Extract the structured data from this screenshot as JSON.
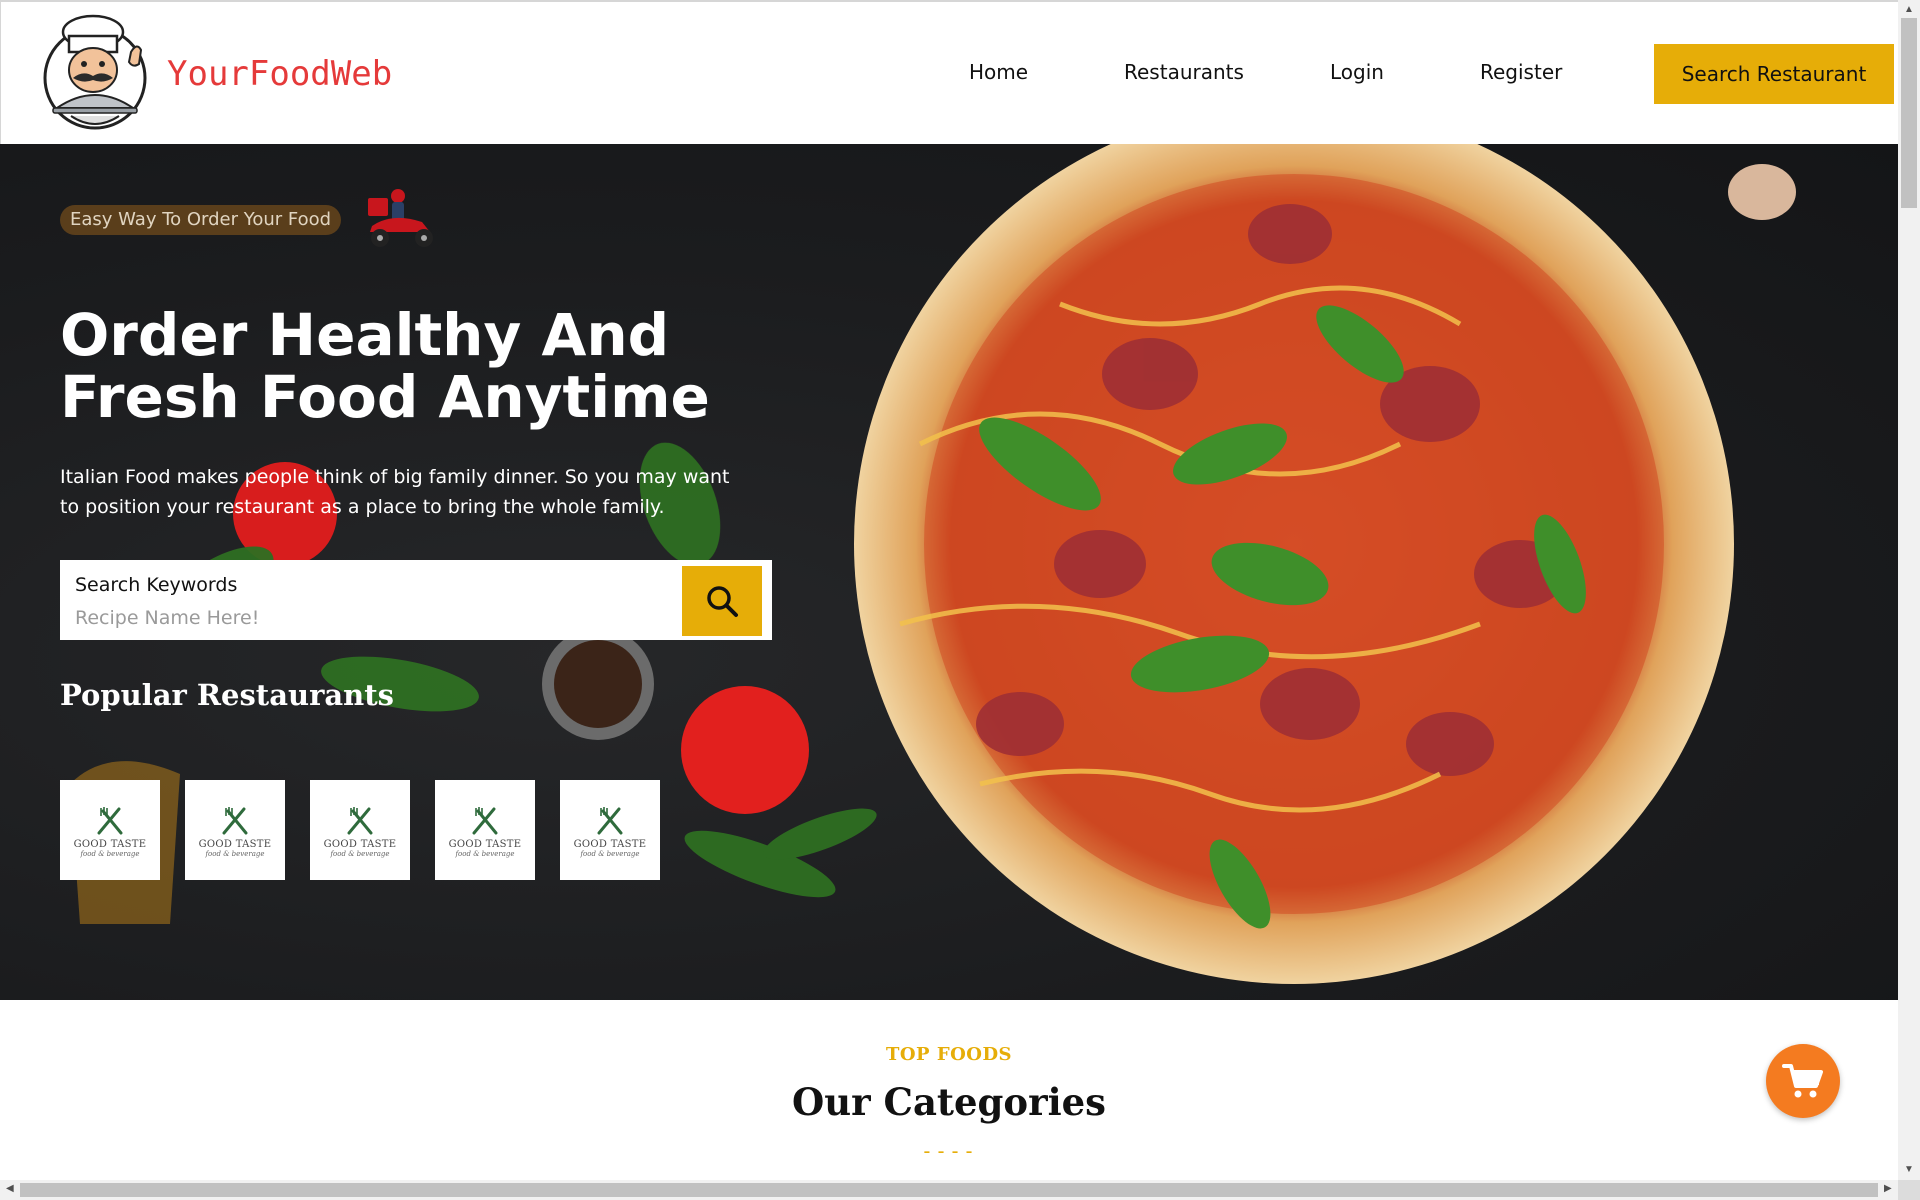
{
  "header": {
    "brand": "YourFoodWeb",
    "logo_icon": "chef-mascot-icon",
    "nav": {
      "home": "Home",
      "restaurants": "Restaurants",
      "login": "Login",
      "register": "Register"
    },
    "cta_label": "Search Restaurant"
  },
  "hero": {
    "tagline": "Easy Way To Order Your Food",
    "tagline_icon": "delivery-scooter-icon",
    "headline": "Order Healthy And Fresh Food Anytime",
    "description": "Italian Food makes people think of big family dinner. So you may want to position your restaurant as a place to bring the whole family.",
    "search": {
      "label": "Search Keywords",
      "placeholder": "Recipe Name Here!",
      "button_icon": "search-icon"
    },
    "popular_title": "Popular Restaurants",
    "restaurants": [
      {
        "name": "GOOD TASTE",
        "subtitle": "food & beverage"
      },
      {
        "name": "GOOD TASTE",
        "subtitle": "food & beverage"
      },
      {
        "name": "GOOD TASTE",
        "subtitle": "food & beverage"
      },
      {
        "name": "GOOD TASTE",
        "subtitle": "food & beverage"
      },
      {
        "name": "GOOD TASTE",
        "subtitle": "food & beverage"
      }
    ]
  },
  "categories": {
    "kicker": "TOP FOODS",
    "title": "Our Categories",
    "divider": "----"
  },
  "cart_icon": "shopping-cart-icon",
  "colors": {
    "accent": "#e6ad08",
    "brand_red": "#e53a3a",
    "cart_orange": "#f47b20",
    "hero_background": "#1b1c1e"
  }
}
